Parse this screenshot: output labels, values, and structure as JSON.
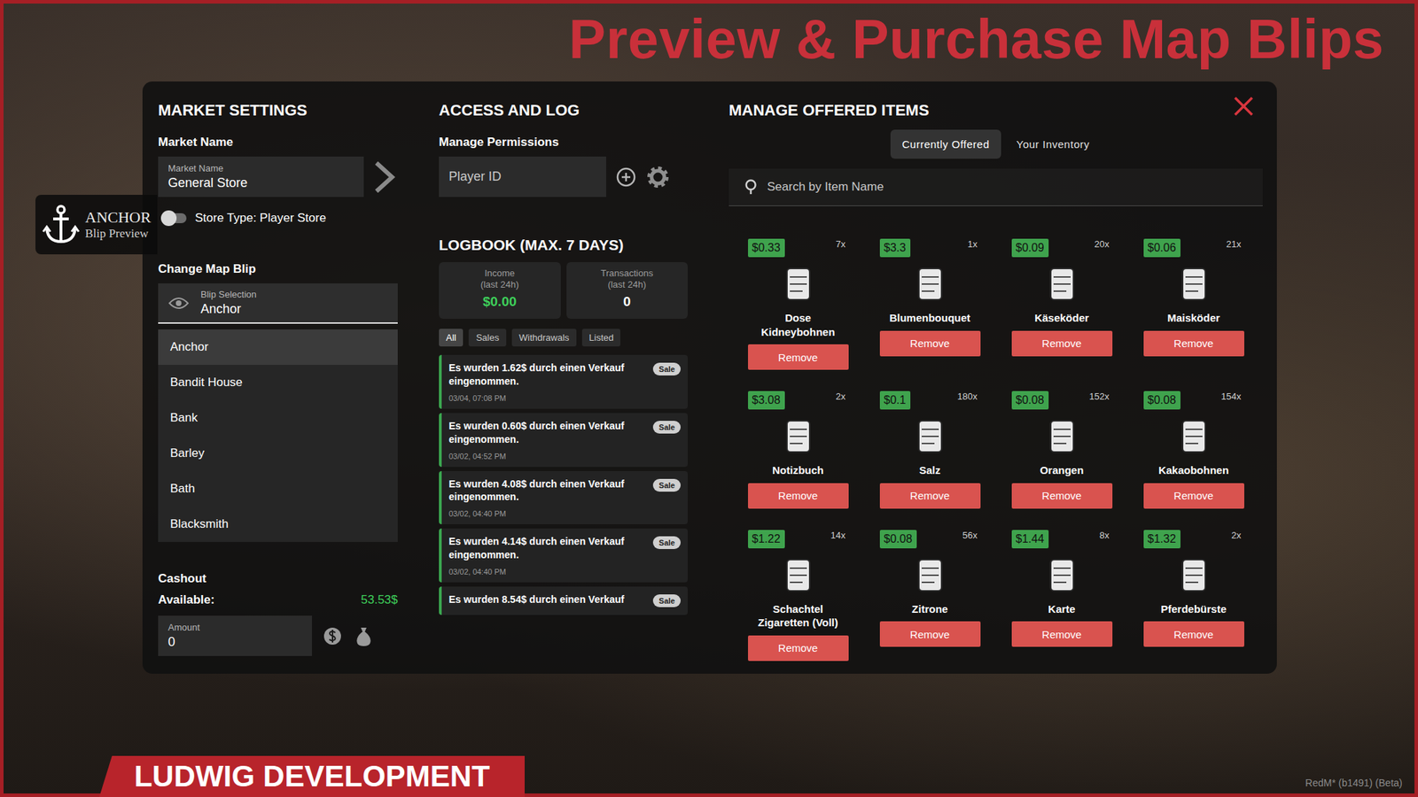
{
  "promo": {
    "title": "Preview & Purchase Map Blips",
    "brand": "LUDWIG DEVELOPMENT",
    "build": "RedM* (b1491) (Beta)"
  },
  "blip_preview": {
    "name": "ANCHOR",
    "label": "Blip Preview"
  },
  "market_settings": {
    "title": "MARKET SETTINGS",
    "name_label": "Market Name",
    "field_label": "Market Name",
    "field_value": "General Store",
    "store_type": {
      "label": "Store Type: Player Store",
      "on": false
    },
    "blip_title": "Change Map Blip",
    "blip_field_label": "Blip Selection",
    "blip_value": "Anchor",
    "blip_options": [
      {
        "label": "Anchor",
        "selected": true
      },
      {
        "label": "Bandit House",
        "selected": false
      },
      {
        "label": "Bank",
        "selected": false
      },
      {
        "label": "Barley",
        "selected": false
      },
      {
        "label": "Bath",
        "selected": false
      },
      {
        "label": "Blacksmith",
        "selected": false
      }
    ],
    "cashout": {
      "title": "Cashout",
      "available_label": "Available:",
      "available_value": "53.53$",
      "amount_label": "Amount",
      "amount_value": "0"
    }
  },
  "access_log": {
    "title": "ACCESS AND LOG",
    "permissions_label": "Manage Permissions",
    "player_placeholder": "Player ID",
    "logbook_title": "LOGBOOK (MAX. 7 DAYS)",
    "stats": [
      {
        "label": "Income",
        "sub": "(last 24h)",
        "value": "$0.00",
        "color": "#3ecf5a"
      },
      {
        "label": "Transactions",
        "sub": "(last 24h)",
        "value": "0",
        "color": "#ffffff"
      }
    ],
    "filters": [
      {
        "label": "All",
        "selected": true
      },
      {
        "label": "Sales",
        "selected": false
      },
      {
        "label": "Withdrawals",
        "selected": false
      },
      {
        "label": "Listed",
        "selected": false
      }
    ],
    "entries": [
      {
        "text": "Es wurden 1.62$ durch einen Verkauf eingenommen.",
        "date": "03/04, 07:08 PM",
        "badge": "Sale"
      },
      {
        "text": "Es wurden 0.60$ durch einen Verkauf eingenommen.",
        "date": "03/02, 04:52 PM",
        "badge": "Sale"
      },
      {
        "text": "Es wurden 4.08$ durch einen Verkauf eingenommen.",
        "date": "03/02, 04:40 PM",
        "badge": "Sale"
      },
      {
        "text": "Es wurden 4.14$ durch einen Verkauf eingenommen.",
        "date": "03/02, 04:40 PM",
        "badge": "Sale"
      },
      {
        "text": "Es wurden 8.54$ durch einen Verkauf",
        "badge": "Sale"
      }
    ]
  },
  "offered_items": {
    "title": "MANAGE OFFERED ITEMS",
    "tabs": [
      {
        "label": "Currently Offered",
        "selected": true
      },
      {
        "label": "Your Inventory",
        "selected": false
      }
    ],
    "search_placeholder": "Search by Item Name",
    "items": [
      {
        "price": "$0.33",
        "qty": "7x",
        "name": "Dose Kidneybohnen",
        "button": "Remove"
      },
      {
        "price": "$3.3",
        "qty": "1x",
        "name": "Blumenbouquet",
        "button": "Remove"
      },
      {
        "price": "$0.09",
        "qty": "20x",
        "name": "Käseköder",
        "button": "Remove"
      },
      {
        "price": "$0.06",
        "qty": "21x",
        "name": "Maisköder",
        "button": "Remove"
      },
      {
        "price": "$3.08",
        "qty": "2x",
        "name": "Notizbuch",
        "button": "Remove"
      },
      {
        "price": "$0.1",
        "qty": "180x",
        "name": "Salz",
        "button": "Remove"
      },
      {
        "price": "$0.08",
        "qty": "152x",
        "name": "Orangen",
        "button": "Remove"
      },
      {
        "price": "$0.08",
        "qty": "154x",
        "name": "Kakaobohnen",
        "button": "Remove"
      },
      {
        "price": "$1.22",
        "qty": "14x",
        "name": "Schachtel Zigaretten (Voll)",
        "button": "Remove"
      },
      {
        "price": "$0.08",
        "qty": "56x",
        "name": "Zitrone",
        "button": "Remove"
      },
      {
        "price": "$1.44",
        "qty": "8x",
        "name": "Karte",
        "button": "Remove"
      },
      {
        "price": "$1.32",
        "qty": "2x",
        "name": "Pferdebürste",
        "button": "Remove"
      }
    ]
  }
}
